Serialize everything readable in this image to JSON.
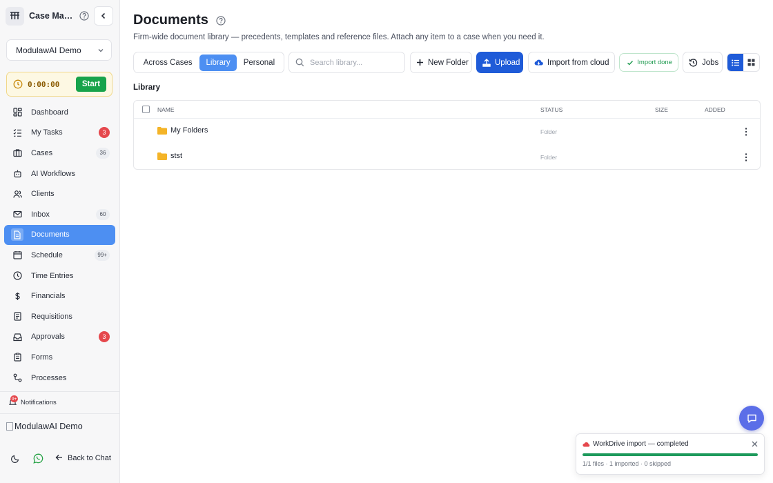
{
  "sidebar": {
    "app_title": "Case Management",
    "workspace": "ModulawAI Demo",
    "timer": {
      "value": "0:00:00",
      "start_label": "Start"
    },
    "items": [
      {
        "label": "Dashboard",
        "icon": "dashboard-icon",
        "badge": ""
      },
      {
        "label": "My Tasks",
        "icon": "tasks-icon",
        "badge": "3",
        "badge_style": "red"
      },
      {
        "label": "Cases",
        "icon": "briefcase-icon",
        "badge": "36",
        "badge_style": "gray"
      },
      {
        "label": "AI Workflows",
        "icon": "ai-workflow-icon",
        "badge": ""
      },
      {
        "label": "Clients",
        "icon": "users-icon",
        "badge": ""
      },
      {
        "label": "Inbox",
        "icon": "mail-icon",
        "badge": "60",
        "badge_style": "gray"
      },
      {
        "label": "Documents",
        "icon": "document-icon",
        "badge": "",
        "active": true
      },
      {
        "label": "Schedule",
        "icon": "calendar-icon",
        "badge": "99+",
        "badge_style": "gray"
      },
      {
        "label": "Time Entries",
        "icon": "clock-icon",
        "badge": ""
      },
      {
        "label": "Financials",
        "icon": "dollar-icon",
        "badge": ""
      },
      {
        "label": "Requisitions",
        "icon": "requisition-icon",
        "badge": ""
      },
      {
        "label": "Approvals",
        "icon": "inbox-tray-icon",
        "badge": "3",
        "badge_style": "red"
      },
      {
        "label": "Forms",
        "icon": "clipboard-icon",
        "badge": ""
      },
      {
        "label": "Processes",
        "icon": "process-icon",
        "badge": ""
      }
    ],
    "notifications": {
      "label": "Notifications",
      "badge": "9+"
    },
    "user_image_alt": "ModulawAI Demo",
    "back_to_chat": "Back to Chat"
  },
  "header": {
    "title": "Documents",
    "subtitle": "Firm-wide document library — precedents, templates and reference files. Attach any item to a case when you need it."
  },
  "toolbar": {
    "tabs": [
      "Across Cases",
      "Library",
      "Personal"
    ],
    "active_tab": "Library",
    "search_placeholder": "Search library...",
    "new_folder": "New Folder",
    "upload": "Upload",
    "import_cloud": "Import from cloud",
    "import_done": "Import done",
    "jobs": "Jobs",
    "view_mode": "list"
  },
  "library": {
    "section_title": "Library",
    "columns": {
      "name": "NAME",
      "status": "STATUS",
      "size": "SIZE",
      "added": "ADDED"
    },
    "rows": [
      {
        "name": "My Folders",
        "status": "Folder",
        "size": "",
        "added": ""
      },
      {
        "name": "stst",
        "status": "Folder",
        "size": "",
        "added": ""
      }
    ]
  },
  "toast": {
    "title": "WorkDrive import — completed",
    "progress": 1.0,
    "meta": "1/1 files · 1 imported · 0 skipped"
  },
  "colors": {
    "accent": "#4d8ff2",
    "primary": "#1f5bd8",
    "success": "#1e9a5c",
    "danger": "#e5484d"
  }
}
